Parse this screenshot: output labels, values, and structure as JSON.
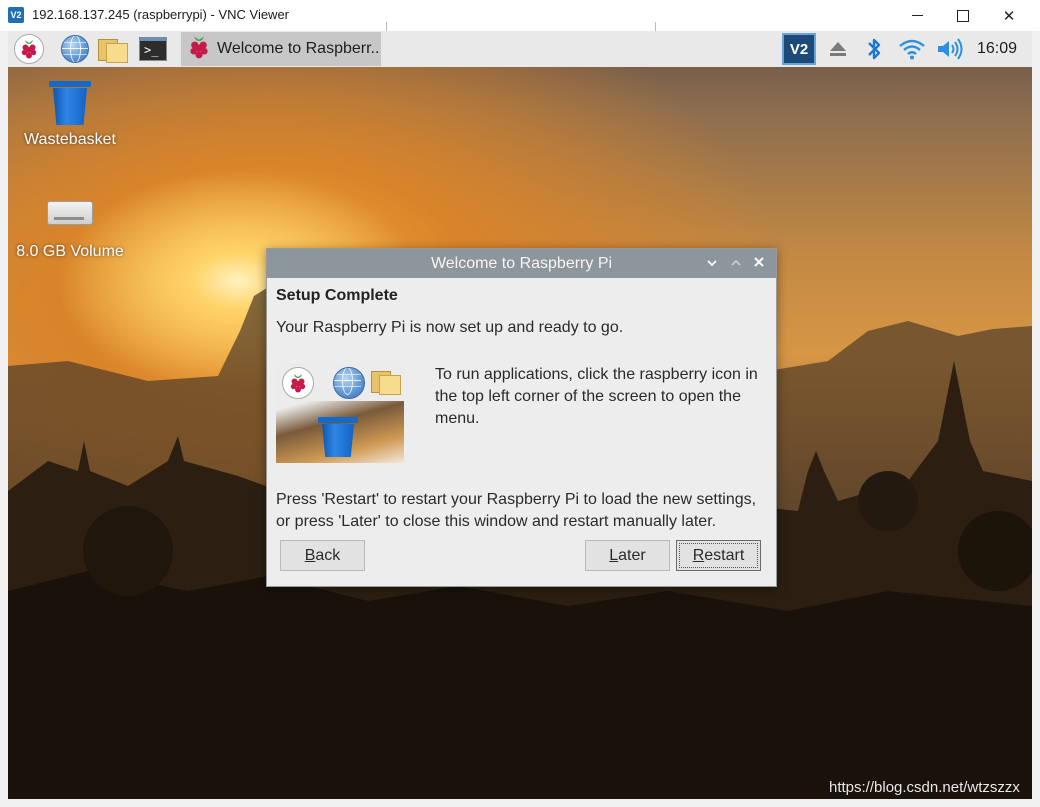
{
  "vnc_window": {
    "logo_text": "V2",
    "title": "192.168.137.245 (raspberrypi) - VNC Viewer",
    "minimize": "",
    "maximize": "",
    "close": "✕"
  },
  "taskbar": {
    "task_button_label": "Welcome to Raspberr...",
    "tray_vnc_label": "V2",
    "clock": "16:09",
    "icons": [
      "raspberry-menu-icon",
      "web-browser-icon",
      "file-manager-icon",
      "terminal-icon",
      "eject-icon",
      "bluetooth-icon",
      "wifi-icon",
      "volume-icon"
    ]
  },
  "desktop": {
    "icons": [
      {
        "label": "Wastebasket",
        "icon": "trash-icon"
      },
      {
        "label": "8.0 GB Volume",
        "icon": "drive-icon"
      }
    ]
  },
  "dialog": {
    "title": "Welcome to Raspberry Pi",
    "heading": "Setup Complete",
    "subtitle": "Your Raspberry Pi is now set up and ready to go.",
    "info": "To run applications, click the raspberry icon in the top left corner of the screen to open the menu.",
    "restart_text": "Press 'Restart' to restart your Raspberry Pi to load the new settings, or press 'Later' to close this window and restart manually later.",
    "buttons": {
      "back": {
        "mnemonic": "B",
        "rest": "ack"
      },
      "later": {
        "mnemonic": "L",
        "rest": "ater"
      },
      "restart": {
        "mnemonic": "R",
        "rest": "estart"
      }
    }
  },
  "watermark": "https://blog.csdn.net/wtzszzx",
  "colors": {
    "dialog_titlebar": "#8d969d",
    "taskbar": "#e9e9e9",
    "bin_blue": "#1769c9",
    "bluetooth_blue": "#1f79d4"
  }
}
